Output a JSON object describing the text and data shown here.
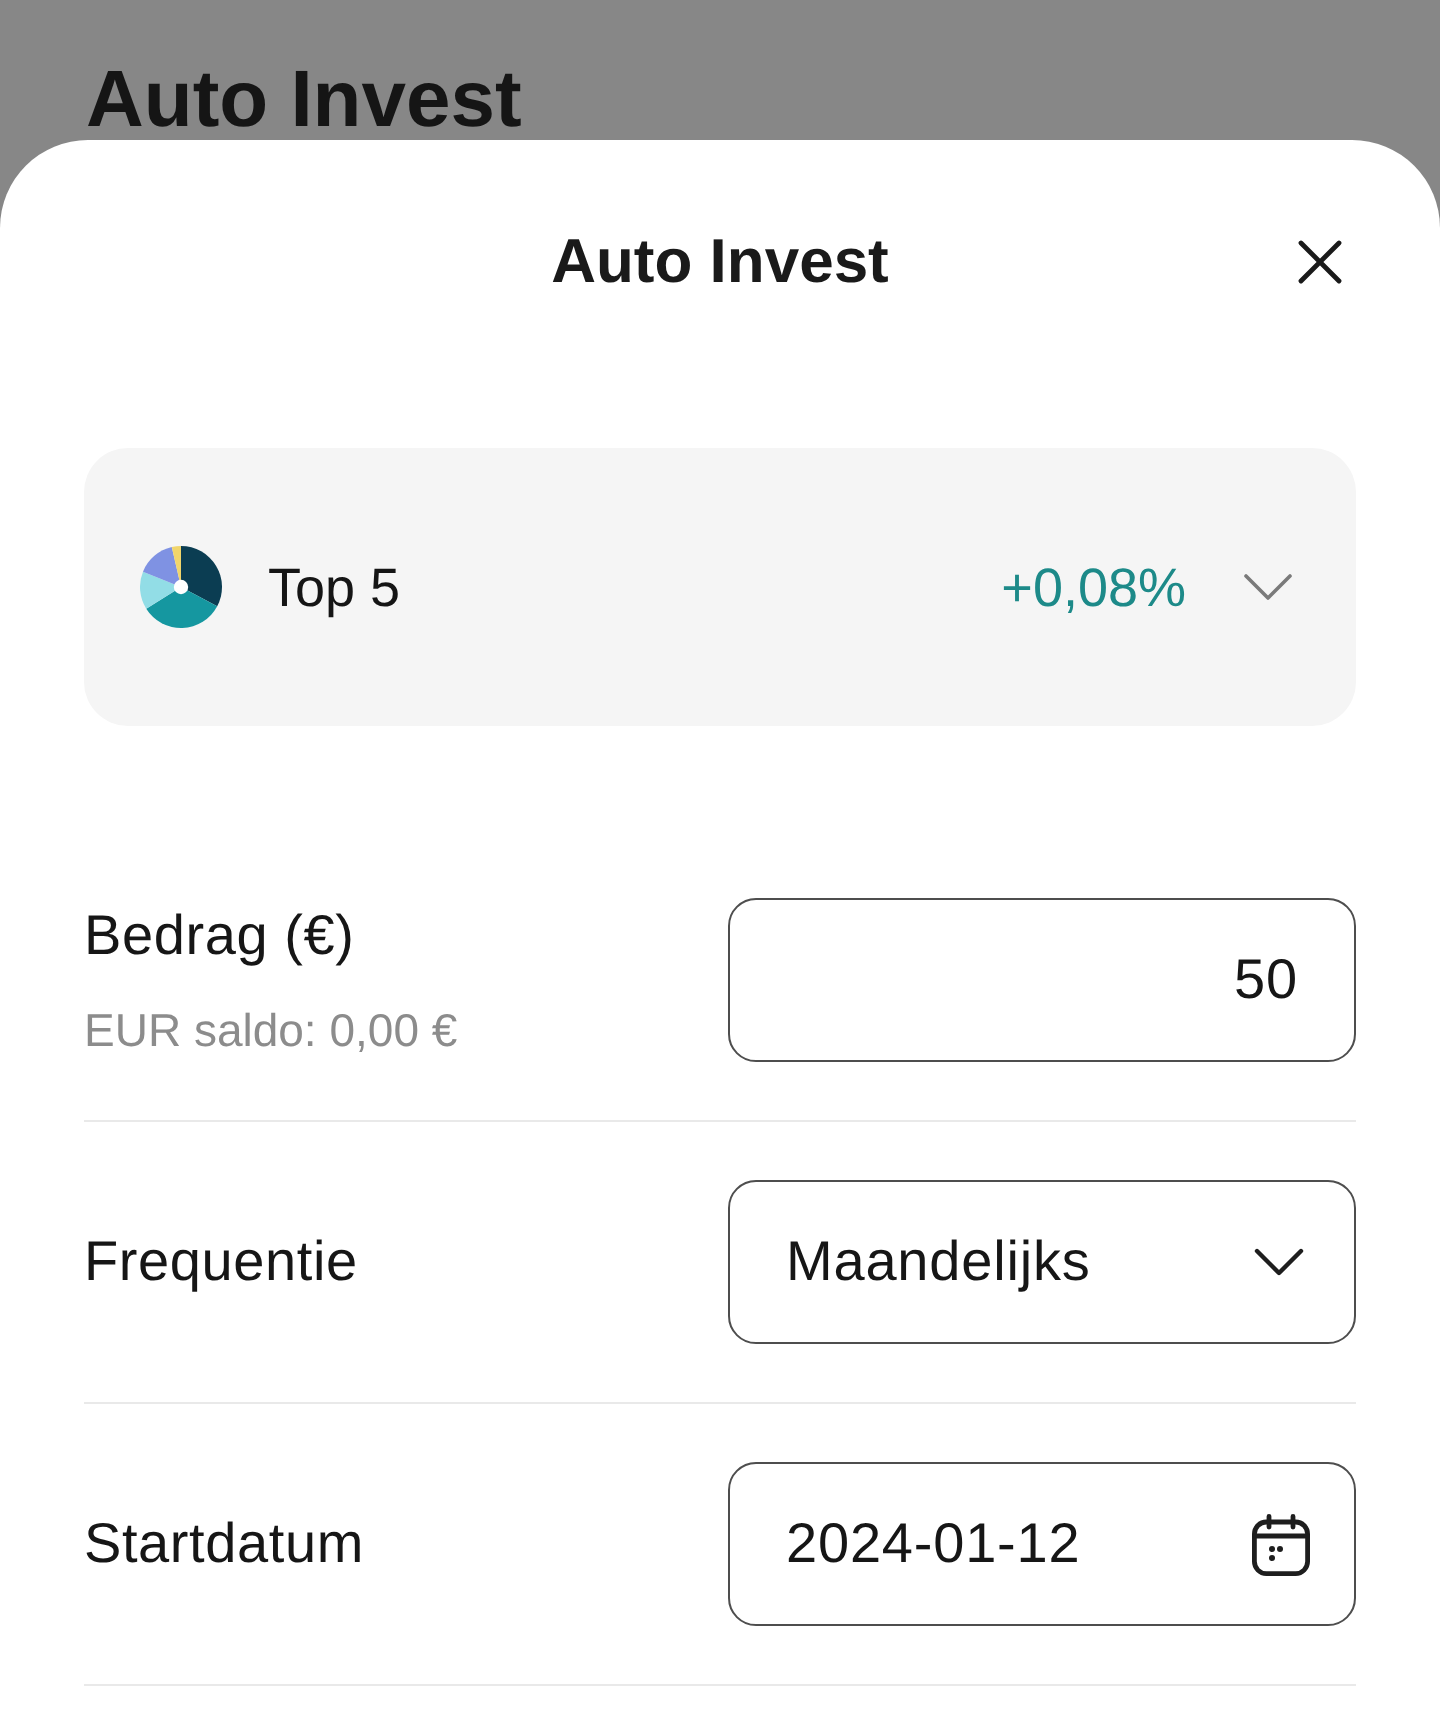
{
  "background": {
    "title": "Auto Invest"
  },
  "sheet": {
    "title": "Auto Invest",
    "portfolio": {
      "name": "Top 5",
      "change": "+0,08%"
    },
    "fields": [
      {
        "kind": "number",
        "label": "Bedrag (€)",
        "hint": "EUR saldo: 0,00 €",
        "value": "50"
      },
      {
        "kind": "select",
        "label": "Frequentie",
        "value": "Maandelijks"
      },
      {
        "kind": "date",
        "label": "Startdatum",
        "value": "2024-01-12"
      }
    ]
  }
}
